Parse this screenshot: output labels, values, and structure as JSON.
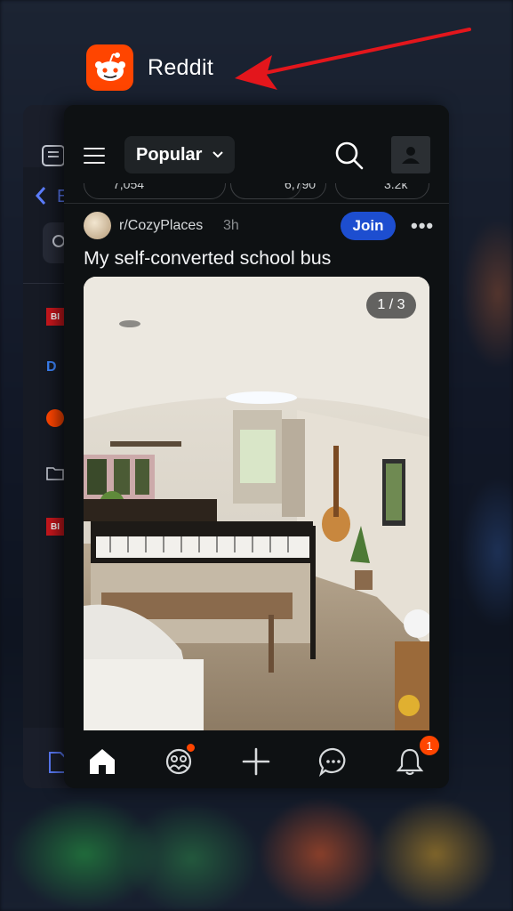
{
  "switcher": {
    "app_name": "Reddit",
    "back_app_initial": "E",
    "back_app_badges": [
      "BI",
      "D",
      "BI"
    ]
  },
  "reddit": {
    "feed_selector": "Popular",
    "action_counts": [
      "7,054",
      "",
      "6,790",
      "3.2k"
    ],
    "post": {
      "subreddit": "r/CozyPlaces",
      "age": "3h",
      "join_label": "Join",
      "more_label": "•••",
      "title": "My self-converted school bus",
      "image_counter": "1 / 3"
    },
    "nav": {
      "notifications_count": "1"
    }
  },
  "colors": {
    "reddit_orange": "#ff4500",
    "join_blue": "#1d4ed0",
    "annotation_arrow": "#e3161c",
    "background": "#0e1113"
  },
  "icons": [
    "reddit-logo-icon",
    "menu-icon",
    "chevron-down-icon",
    "search-icon",
    "profile-icon",
    "home-icon",
    "communities-icon",
    "create-icon",
    "chat-icon",
    "bell-icon",
    "more-icon"
  ]
}
